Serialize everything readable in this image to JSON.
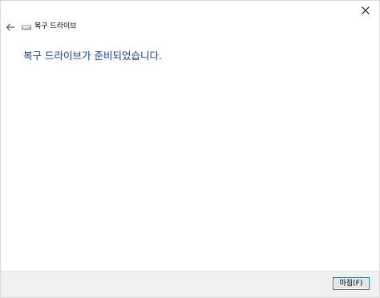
{
  "window": {
    "title": "복구 드라이브"
  },
  "main": {
    "heading": "복구 드라이브가 준비되었습니다."
  },
  "footer": {
    "finish_label": "마침(F)"
  },
  "icons": {
    "close": "close-icon",
    "back": "back-arrow-icon",
    "drive": "drive-icon"
  },
  "colors": {
    "heading": "#1e3a8f",
    "button_border": "#2d6fd1",
    "footer_bg": "#f0f0f0"
  }
}
